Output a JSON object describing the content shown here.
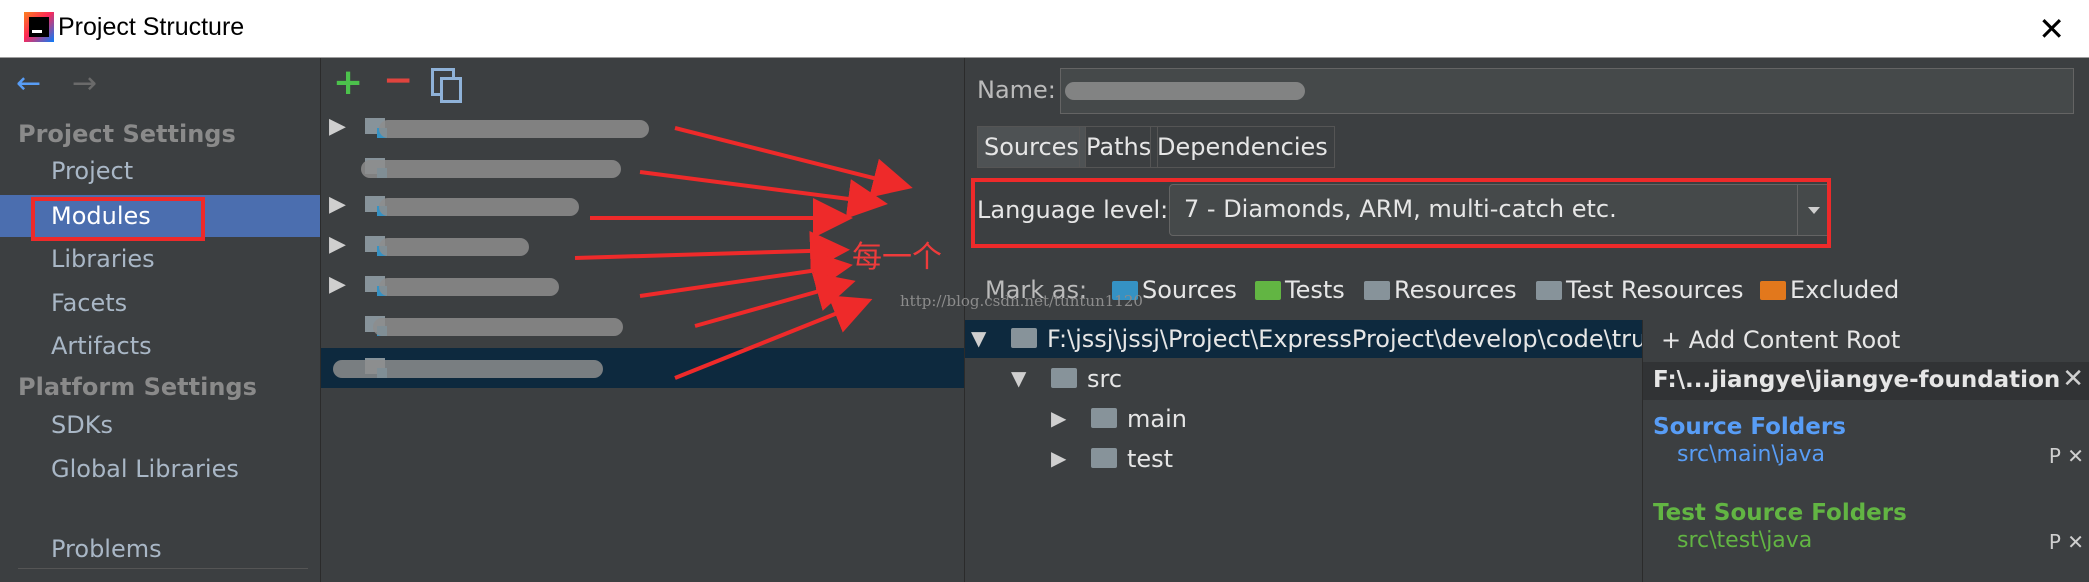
{
  "window": {
    "title": "Project Structure",
    "close": "✕"
  },
  "sidebar": {
    "back_icon": "←",
    "forward_icon": "→",
    "project_settings_heading": "Project Settings",
    "platform_settings_heading": "Platform Settings",
    "items": [
      "Project",
      "Modules",
      "Libraries",
      "Facets",
      "Artifacts"
    ],
    "platform_items": [
      "SDKs",
      "Global Libraries"
    ],
    "problems": "Problems",
    "selected": "Modules"
  },
  "modules_toolbar": {
    "add": "+",
    "remove": "−"
  },
  "annotation": {
    "text": "每一个",
    "watermark": "http://blog.csdn.net/tuntun1120"
  },
  "module_editor": {
    "name_label": "Name:",
    "tabs": [
      "Sources",
      "Paths",
      "Dependencies"
    ],
    "language_level_label": "Language level:",
    "language_level_value": "7 - Diamonds, ARM, multi-catch etc.",
    "mark_as_label": "Mark as:",
    "mark_as": [
      "Sources",
      "Tests",
      "Resources",
      "Test Resources",
      "Excluded"
    ],
    "tree": {
      "root": "F:\\jssj\\jssj\\Project\\ExpressProject\\develop\\code\\trun",
      "src": "src",
      "main": "main",
      "test": "test"
    },
    "content_root": {
      "add_label": "+ Add Content Root",
      "path": "F:\\...jiangye\\jiangye-foundation",
      "source_folders_heading": "Source Folders",
      "source_folder": "src\\main\\java",
      "test_source_folders_heading": "Test Source Folders",
      "test_source_folder": "src\\test\\java",
      "folder_tool": "P",
      "remove": "✕"
    }
  },
  "colors": {
    "accent": "#4b6eaf",
    "annotation_red": "#ee2a2a",
    "sources_blue": "#589df6",
    "tests_green": "#62b543"
  }
}
